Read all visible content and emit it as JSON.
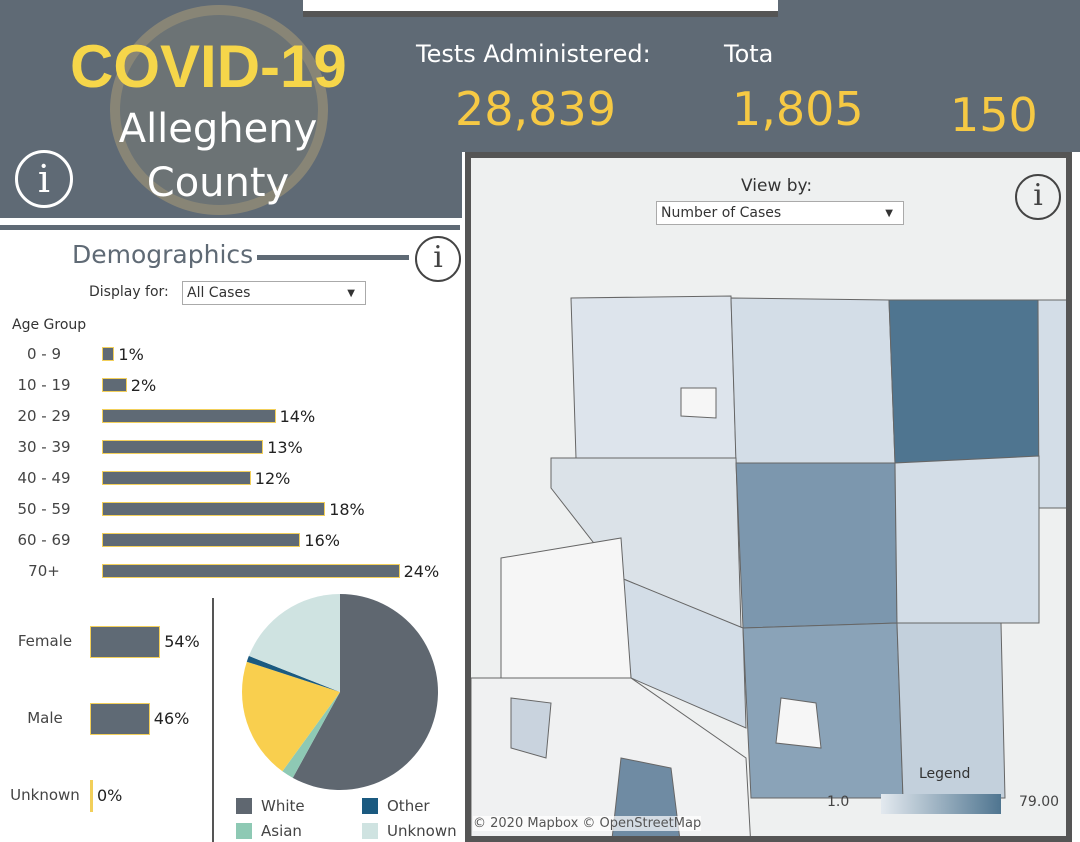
{
  "header": {
    "title": "COVID-19",
    "subtitle_1": "Allegheny",
    "subtitle_2": "County",
    "info_icon": "info-icon",
    "stats": [
      {
        "label": "Tests Administered:",
        "value": "28,839"
      },
      {
        "label": "Tota",
        "value": "1,805"
      },
      {
        "label": "",
        "value": "150"
      }
    ]
  },
  "map": {
    "view_by_label": "View by:",
    "view_by_value": "Number of Cases",
    "attribution": "© 2020 Mapbox © OpenStreetMap",
    "legend": {
      "title": "Legend",
      "min": "1.0",
      "max": "79.00",
      "color_low": "#e3e9ef",
      "color_high": "#4f7590"
    }
  },
  "demographics": {
    "title": "Demographics",
    "display_for_label": "Display for:",
    "display_for_value": "All Cases",
    "age_group_label": "Age Group"
  },
  "colors": {
    "accent_yellow": "#f6d64a",
    "header": "#5f6a75",
    "white": "#5f6770",
    "asian": "#8ec9b4",
    "other": "#1b5a80",
    "unknown": "#cfe3e1",
    "black": "#f9cf4e"
  },
  "chart_data": [
    {
      "type": "bar",
      "orientation": "horizontal",
      "title": "Age Group",
      "categories": [
        "0 - 9",
        "10 - 19",
        "20 - 29",
        "30 - 39",
        "40 - 49",
        "50 - 59",
        "60 - 69",
        "70+"
      ],
      "values": [
        1,
        2,
        14,
        13,
        12,
        18,
        16,
        24
      ],
      "labels": [
        "1%",
        "2%",
        "14%",
        "13%",
        "12%",
        "18%",
        "16%",
        "24%"
      ]
    },
    {
      "type": "bar",
      "orientation": "horizontal",
      "categories": [
        "Female",
        "Male",
        "Unknown"
      ],
      "values": [
        54,
        46,
        0
      ],
      "labels": [
        "54%",
        "46%",
        "0%"
      ]
    },
    {
      "type": "pie",
      "legend": [
        "White",
        "Other",
        "Asian",
        "Unknown"
      ],
      "slices": [
        {
          "name": "White",
          "value": 58
        },
        {
          "name": "Asian",
          "value": 2
        },
        {
          "name": "",
          "value": 20
        },
        {
          "name": "Other",
          "value": 1
        },
        {
          "name": "Unknown",
          "value": 19
        }
      ]
    }
  ]
}
